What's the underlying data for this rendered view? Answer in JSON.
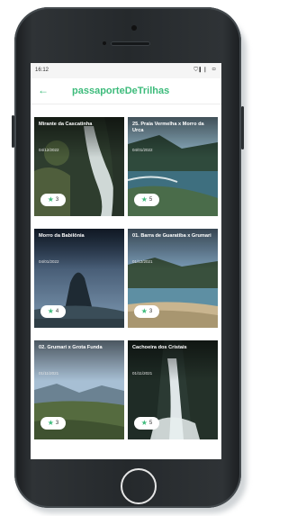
{
  "status": {
    "time": "16:12",
    "icons": "⛉ ▎▏ ▭"
  },
  "app": {
    "back_icon": "←",
    "title": "passaporteDeTrilhas"
  },
  "trails": [
    {
      "title": "Mirante da Cascatinha",
      "date": "04/12/2022",
      "rating": "3",
      "scene": "waterfall"
    },
    {
      "title": "25. Praia Vermelha x Morro da Urca",
      "date": "04/01/2022",
      "rating": "5",
      "scene": "coast"
    },
    {
      "title": "Morro da Babilônia",
      "date": "04/01/2022",
      "rating": "4",
      "scene": "sugarloaf"
    },
    {
      "title": "01. Barra de Guaratiba x Grumari",
      "date": "01/12/2021",
      "rating": "3",
      "scene": "beach"
    },
    {
      "title": "02. Grumari x Grota Funda",
      "date": "01/11/2021",
      "rating": "3",
      "scene": "valley"
    },
    {
      "title": "Cachoeira dos Cristais",
      "date": "01/11/2021",
      "rating": "5",
      "scene": "falls"
    }
  ],
  "colors": {
    "accent": "#3dbb7b"
  }
}
